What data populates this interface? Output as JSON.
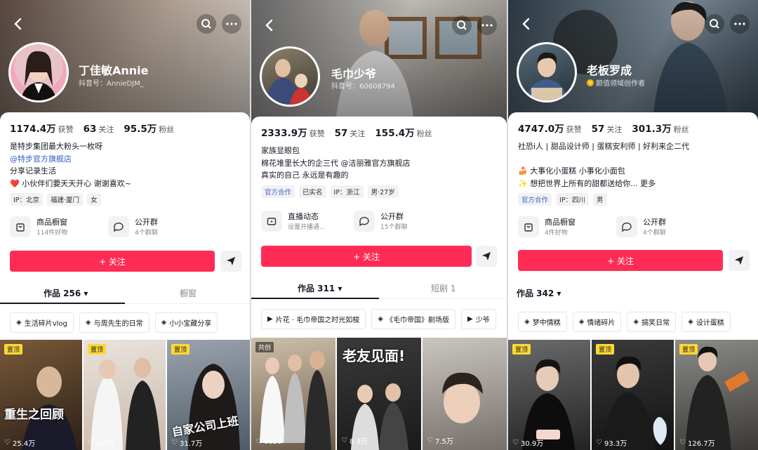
{
  "panels": [
    {
      "name": "丁佳敏Annie",
      "id_label": "抖音号：AnnieDJM_",
      "stats": [
        {
          "num": "1174.4万",
          "label": "获赞"
        },
        {
          "num": "63",
          "label": "关注"
        },
        {
          "num": "95.5万",
          "label": "粉丝"
        }
      ],
      "bio": [
        "是特步集团最大粉头一枚呀",
        "@特步官方旗舰店",
        "分享记录生活",
        "❤️ 小伙伴们要天天开心 谢谢喜欢~"
      ],
      "tags": [
        "IP：北京",
        "福建·厦门",
        "女"
      ],
      "tools": [
        {
          "title": "商品橱窗",
          "sub": "114件好物"
        },
        {
          "title": "公开群",
          "sub": "4个群聊"
        }
      ],
      "follow": "+ 关注",
      "tabs": [
        "作品 256 ▾",
        "橱窗"
      ],
      "collections": [
        "生活碎片vlog",
        "与周先生的日常",
        "小小宝藏分享"
      ],
      "videos": [
        {
          "badge": "置顶",
          "likes": "25.4万",
          "caption": "重生之回顾"
        },
        {
          "badge": "置顶",
          "likes": "9.5万",
          "caption": ""
        },
        {
          "badge": "置顶",
          "likes": "31.7万",
          "caption": "自家公司上班"
        }
      ]
    },
    {
      "name": "毛巾少爷",
      "id_label": "抖音号：60608794",
      "stats": [
        {
          "num": "2333.9万",
          "label": "获赞"
        },
        {
          "num": "57",
          "label": "关注"
        },
        {
          "num": "155.4万",
          "label": "粉丝"
        }
      ],
      "bio": [
        "家族显眼包",
        "棉花堆里长大的企三代 @洁丽雅官方旗舰店",
        "真实的自己 永远是有趣的"
      ],
      "tags": [
        "官方合作",
        "已实名",
        "IP：浙江",
        "男·27岁"
      ],
      "tools": [
        {
          "title": "直播动态",
          "sub": "设置开播通..."
        },
        {
          "title": "公开群",
          "sub": "15个群聊"
        }
      ],
      "follow": "+ 关注",
      "tabs": [
        "作品 311 ▾",
        "短剧 1"
      ],
      "collections": [
        "片花 · 毛巾帝国之时光如梭",
        "《毛巾帝国》剧场版",
        "少爷"
      ],
      "videos": [
        {
          "badge": "共创",
          "likes": "6630",
          "caption": ""
        },
        {
          "badge": "",
          "likes": "8.9万",
          "caption": "老友见面!"
        },
        {
          "badge": "",
          "likes": "7.5万",
          "caption": ""
        }
      ]
    },
    {
      "name": "老板罗成",
      "id_label": "颜值领域创作者",
      "stats": [
        {
          "num": "4747.0万",
          "label": "获赞"
        },
        {
          "num": "57",
          "label": "关注"
        },
        {
          "num": "301.3万",
          "label": "粉丝"
        }
      ],
      "bio": [
        "社恐i人 | 甜品设计师 | 蛋糕安利师 | 好利来企二代",
        "",
        "🍰 大事化小蛋糕 小事化小面包",
        "✨ 想把世界上所有的甜都送给你... 更多"
      ],
      "tags": [
        "官方合作",
        "IP：四川",
        "男"
      ],
      "tools": [
        {
          "title": "商品橱窗",
          "sub": "4件好物"
        },
        {
          "title": "公开群",
          "sub": "4个群聊"
        }
      ],
      "follow": "+ 关注",
      "tabs": [
        "作品 342 ▾"
      ],
      "collections": [
        "梦中情糕",
        "情绪碎片",
        "搞笑日常",
        "设计蛋糕"
      ],
      "videos": [
        {
          "badge": "置顶",
          "likes": "30.9万",
          "caption": ""
        },
        {
          "badge": "置顶",
          "likes": "93.3万",
          "caption": ""
        },
        {
          "badge": "置顶",
          "likes": "126.7万",
          "caption": ""
        }
      ]
    }
  ],
  "colors": {
    "accent": "#fe2c55",
    "link": "#2e5dc2"
  }
}
